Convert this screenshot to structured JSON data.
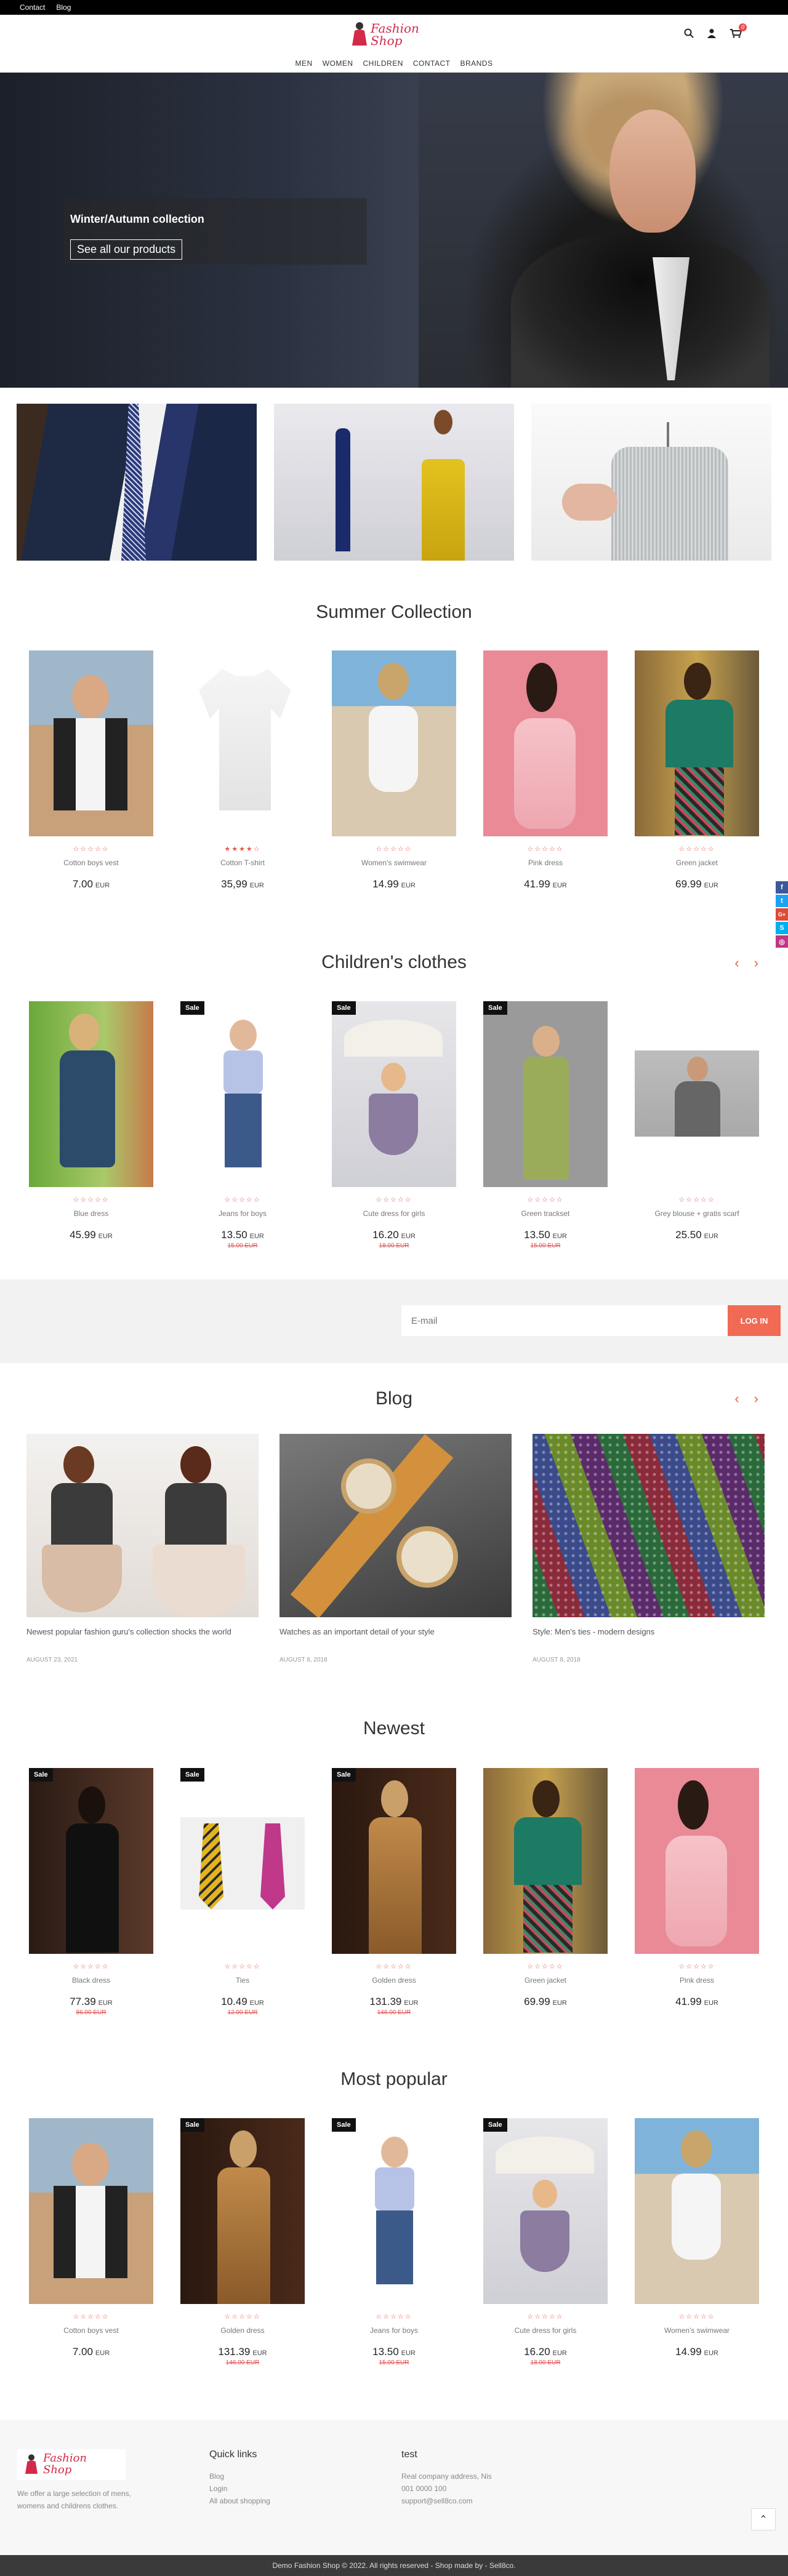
{
  "topbar": {
    "links": [
      "Contact",
      "Blog"
    ]
  },
  "logo": {
    "text_line1": "Fashion",
    "text_line2": "Shop"
  },
  "header": {
    "cart_count": "0"
  },
  "nav": [
    "MEN",
    "WOMEN",
    "CHILDREN",
    "CONTACT",
    "BRANDS"
  ],
  "hero": {
    "title": "Winter/Autumn collection",
    "button": "See all our products"
  },
  "sections": {
    "summer": "Summer Collection",
    "children": "Children's clothes",
    "blog": "Blog",
    "newest": "Newest",
    "popular": "Most popular"
  },
  "sale_label": "Sale",
  "stars": "☆☆☆☆☆",
  "stars_rated": "★★★★☆",
  "currency": "EUR",
  "summer": [
    {
      "name": "Cotton boys vest",
      "price": "7.00"
    },
    {
      "name": "Cotton T-shirt",
      "price": "35,99"
    },
    {
      "name": "Women's swimwear",
      "price": "14.99"
    },
    {
      "name": "Pink dress",
      "price": "41.99"
    },
    {
      "name": "Green jacket",
      "price": "69.99"
    }
  ],
  "children": [
    {
      "name": "Blue dress",
      "price": "45.99",
      "old": ""
    },
    {
      "name": "Jeans for boys",
      "price": "13.50",
      "old": "15.00 EUR"
    },
    {
      "name": "Cute dress for girls",
      "price": "16.20",
      "old": "18.00 EUR"
    },
    {
      "name": "Green trackset",
      "price": "13.50",
      "old": "15.00 EUR"
    },
    {
      "name": "Grey blouse + gratis scarf",
      "price": "25.50",
      "old": ""
    }
  ],
  "newsletter": {
    "placeholder": "E-mail",
    "button": "LOG IN"
  },
  "blog": [
    {
      "title": "Newest popular fashion guru's collection shocks the world",
      "date": "AUGUST 23, 2021"
    },
    {
      "title": "Watches as an important detail of your style",
      "date": "AUGUST 8, 2018"
    },
    {
      "title": "Style: Men's ties - modern designs",
      "date": "AUGUST 8, 2018"
    }
  ],
  "newest": [
    {
      "name": "Black dress",
      "price": "77.39",
      "old": "86.00 EUR"
    },
    {
      "name": "Ties",
      "price": "10.49",
      "old": "12.00 EUR"
    },
    {
      "name": "Golden dress",
      "price": "131.39",
      "old": "146.00 EUR"
    },
    {
      "name": "Green jacket",
      "price": "69.99",
      "old": ""
    },
    {
      "name": "Pink dress",
      "price": "41.99",
      "old": ""
    }
  ],
  "popular": [
    {
      "name": "Cotton boys vest",
      "price": "7.00",
      "old": ""
    },
    {
      "name": "Golden dress",
      "price": "131.39",
      "old": "146.00 EUR"
    },
    {
      "name": "Jeans for boys",
      "price": "13.50",
      "old": "15.00 EUR"
    },
    {
      "name": "Cute dress for girls",
      "price": "16.20",
      "old": "18.00 EUR"
    },
    {
      "name": "Women's swimwear",
      "price": "14.99",
      "old": ""
    }
  ],
  "social": [
    {
      "icon": "facebook-icon",
      "glyph": "f",
      "color": "#3b5998"
    },
    {
      "icon": "twitter-icon",
      "glyph": "t",
      "color": "#1da1f2"
    },
    {
      "icon": "google-plus-icon",
      "glyph": "G+",
      "color": "#dd4b39"
    },
    {
      "icon": "skype-icon",
      "glyph": "S",
      "color": "#00aff0"
    },
    {
      "icon": "instagram-icon",
      "glyph": "◎",
      "color": "#c13584"
    }
  ],
  "footer": {
    "description": "We offer a large selection of mens, womens and childrens clothes.",
    "quicklinks_title": "Quick links",
    "quicklinks": [
      "Blog",
      "Login",
      "All about shopping"
    ],
    "contact_title": "test",
    "contact": [
      "Real company address, Nis",
      "001 0000 100",
      "support@sell8co.com"
    ]
  },
  "copyright": "Demo Fashion Shop © 2022. All rights reserved - Shop made by - Sell8co."
}
